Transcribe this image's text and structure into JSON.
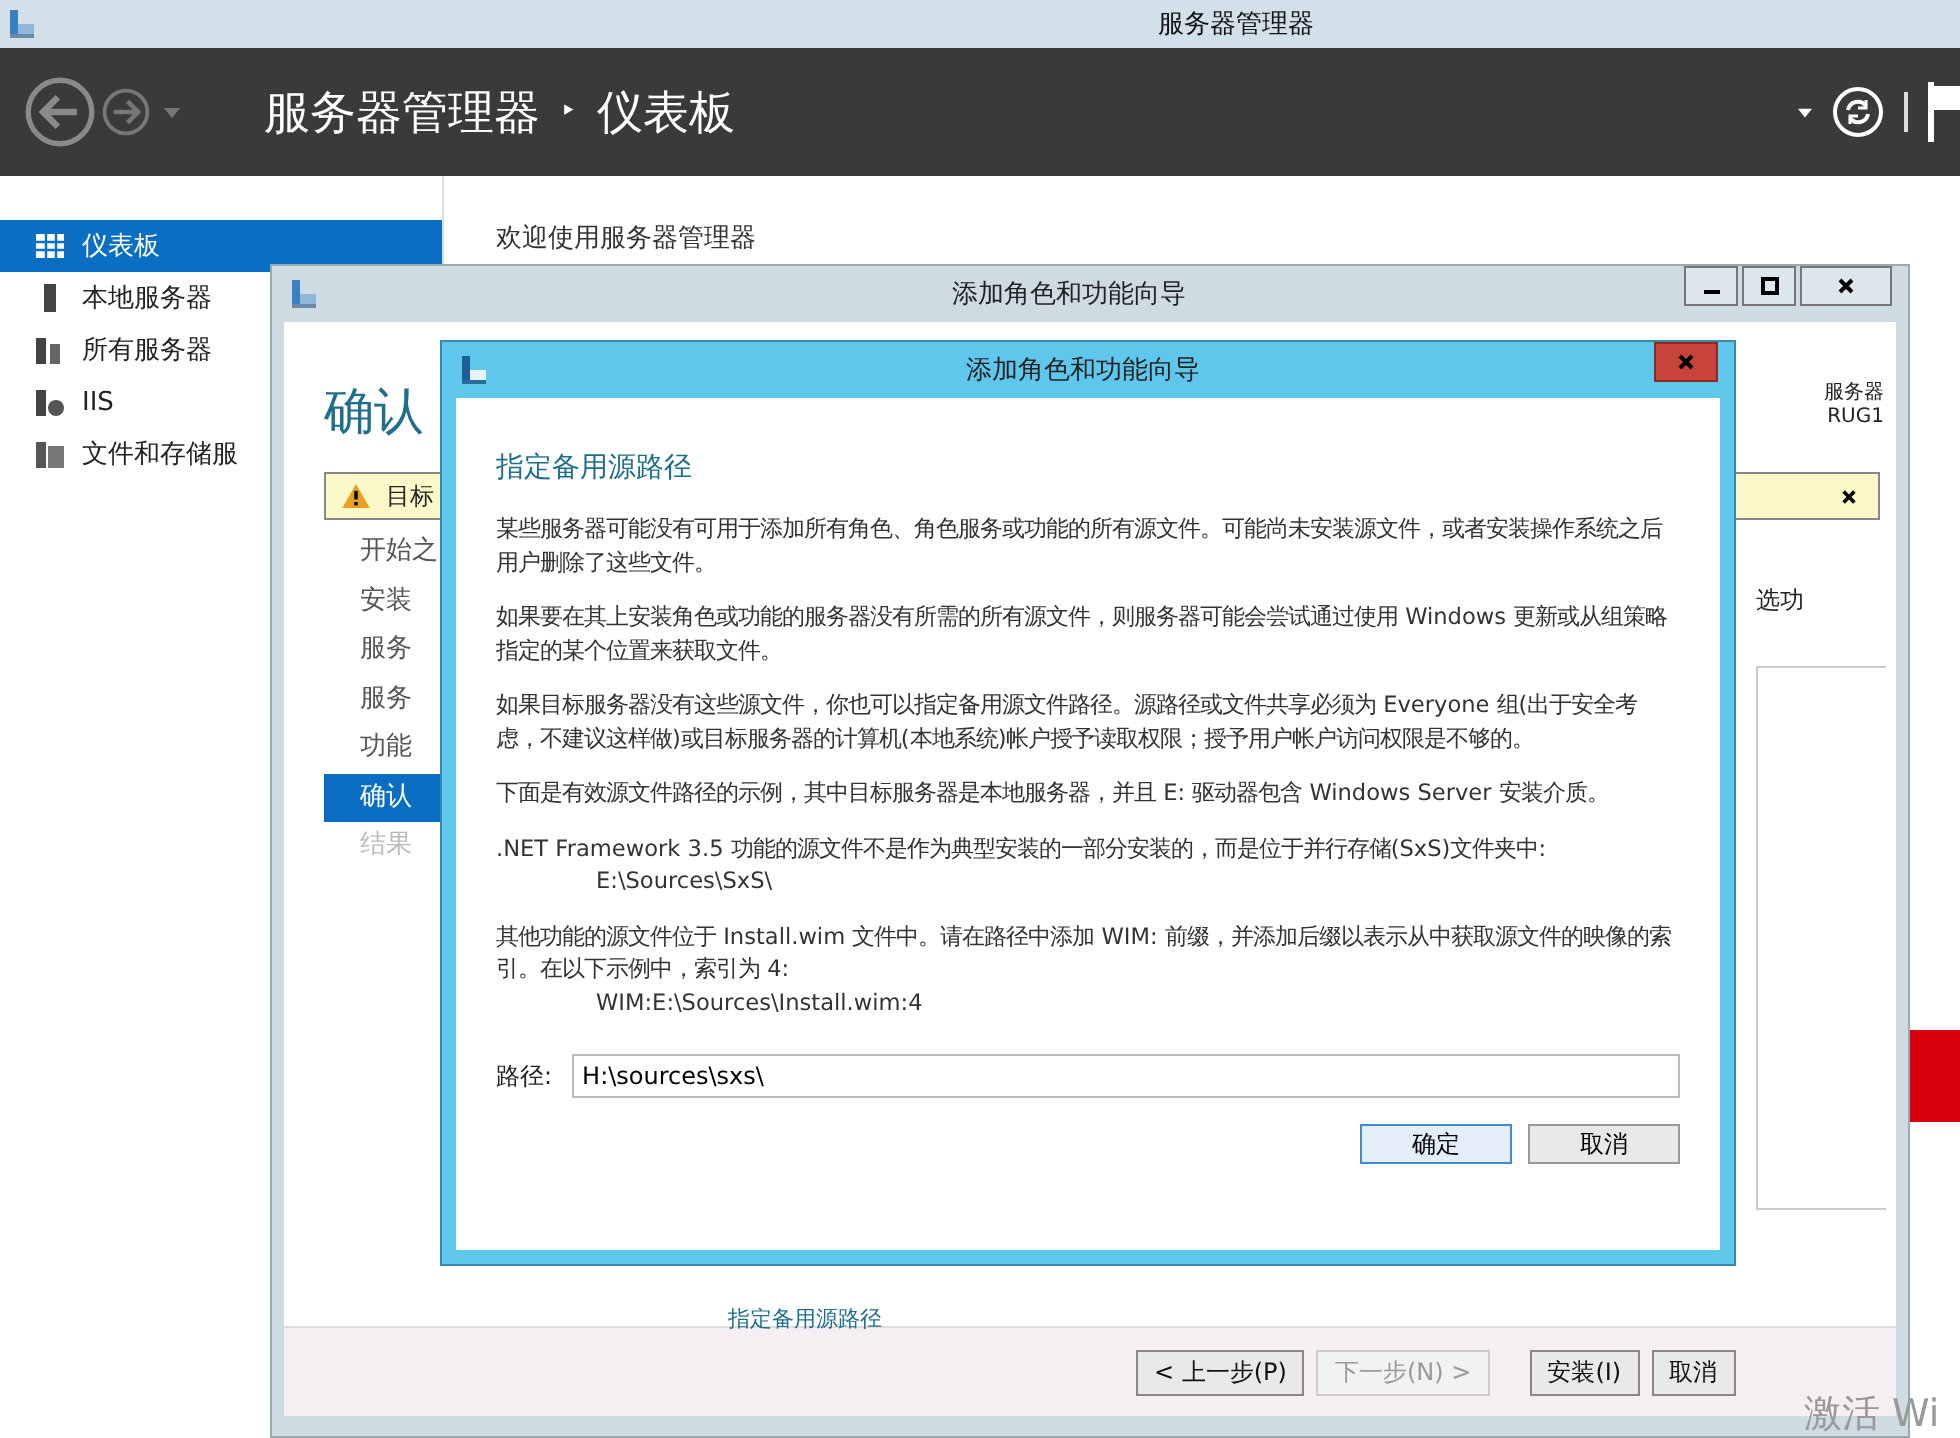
{
  "window": {
    "title": "服务器管理器"
  },
  "header": {
    "breadcrumb": [
      "服务器管理器",
      "仪表板"
    ],
    "separator": "‣"
  },
  "sidebar": {
    "items": [
      {
        "label": "仪表板",
        "kind": "grid",
        "selected": true
      },
      {
        "label": "本地服务器",
        "kind": "server",
        "selected": false
      },
      {
        "label": "所有服务器",
        "kind": "servers",
        "selected": false
      },
      {
        "label": "IIS",
        "kind": "iis",
        "selected": false
      },
      {
        "label": "文件和存储服",
        "kind": "files",
        "selected": false
      }
    ]
  },
  "main": {
    "welcome": "欢迎使用服务器管理器"
  },
  "wizard": {
    "title": "添加角色和功能向导",
    "heading": "确认",
    "server_label": "服务器",
    "server_name": "RUG1",
    "warning": "目标",
    "right_text": "选功",
    "link": "指定备用源路径",
    "steps": [
      {
        "label": "开始之",
        "selected": false,
        "disabled": false
      },
      {
        "label": "安装",
        "selected": false,
        "disabled": false
      },
      {
        "label": "服务",
        "selected": false,
        "disabled": false
      },
      {
        "label": "服务",
        "selected": false,
        "disabled": false
      },
      {
        "label": "功能",
        "selected": false,
        "disabled": false
      },
      {
        "label": "确认",
        "selected": true,
        "disabled": false
      },
      {
        "label": "结果",
        "selected": false,
        "disabled": true
      }
    ],
    "buttons": [
      {
        "label": "< 上一步(P)",
        "disabled": false
      },
      {
        "label": "下一步(N) >",
        "disabled": true
      },
      {
        "label": "安装(I)",
        "disabled": false
      },
      {
        "label": "取消",
        "disabled": false
      }
    ]
  },
  "dialog": {
    "title": "添加角色和功能向导",
    "heading": "指定备用源路径",
    "paragraphs": [
      {
        "text": "某些服务器可能没有可用于添加所有角色、角色服务或功能的所有源文件。可能尚未安装源文件，或者安装操作系统之后用户删除了这些文件。"
      },
      {
        "text": "如果要在其上安装角色或功能的服务器没有所需的所有源文件，则服务器可能会尝试通过使用 Windows 更新或从组策略指定的某个位置来获取文件。"
      },
      {
        "text": "如果目标服务器没有这些源文件，你也可以指定备用源文件路径。源路径或文件共享必须为 Everyone 组(出于安全考虑，不建议这样做)或目标服务器的计算机(本地系统)帐户授予读取权限；授予用户帐户访问权限是不够的。"
      },
      {
        "text": "下面是有效源文件路径的示例，其中目标服务器是本地服务器，并且 E: 驱动器包含 Windows Server 安装介质。"
      },
      {
        "text": ".NET Framework 3.5 功能的源文件不是作为典型安装的一部分安装的，而是位于并行存储(SxS)文件夹中:",
        "example": "E:\\Sources\\SxS\\"
      },
      {
        "text": "其他功能的源文件位于 Install.wim 文件中。请在路径中添加 WIM: 前缀，并添加后缀以表示从中获取源文件的映像的索引。在以下示例中，索引为 4:",
        "example": "WIM:E:\\Sources\\Install.wim:4"
      }
    ],
    "path_label": "路径:",
    "path_value": "H:\\sources\\sxs\\",
    "buttons": [
      {
        "label": "确定",
        "default": true
      },
      {
        "label": "取消",
        "default": false
      }
    ]
  },
  "watermark": {
    "text": "激活 Wi"
  }
}
